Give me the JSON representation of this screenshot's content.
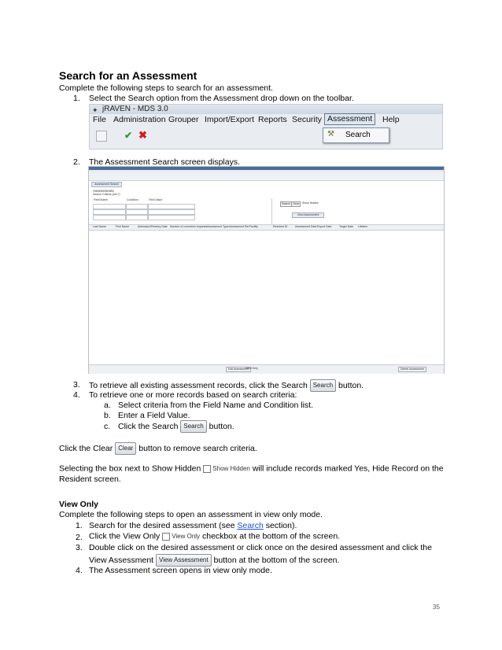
{
  "heading": "Search for an Assessment",
  "intro": "Complete the following steps to search for an assessment.",
  "steps1": [
    {
      "num": "1.",
      "text": "Select the Search option from the Assessment drop down on the toolbar."
    },
    {
      "num": "2.",
      "text": "The Assessment Search screen displays."
    }
  ],
  "toolbar_screenshot": {
    "title": "jRAVEN - MDS 3.0",
    "menus": [
      "File",
      "Administration",
      "Grouper",
      "Import/Export",
      "Reports",
      "Security",
      "Assessment",
      "Help"
    ],
    "dropdown_item": "Search"
  },
  "search_screenshot": {
    "window_title": "Assessment Search",
    "panel_title": "Assessments",
    "criteria_label": "Search Criteria (All=?)",
    "columns_left": [
      "Field Name",
      "Condition",
      "Field Value"
    ],
    "buttons": [
      "Search",
      "Clear",
      "Show Hidden",
      "View Assessment"
    ],
    "result_columns": [
      "Last Name",
      "First Name",
      "Admission/Reentry Date",
      "Number of correction requests",
      "Assessment Type",
      "Assessment Ref",
      "Facility",
      "Resident ID",
      "Assessment Date",
      "Export Date",
      "Target Date",
      "Lifetime"
    ],
    "footer_left": "Edit Assessment",
    "footer_check": "View Only",
    "footer_right": "Delete Assessment"
  },
  "steps2": [
    {
      "num": "3.",
      "pre": "To retrieve all existing assessment records, click the Search",
      "btn": "Search",
      "post": "button."
    },
    {
      "num": "4.",
      "text": "To retrieve one or more records based on search criteria:"
    }
  ],
  "substeps": [
    {
      "letter": "a.",
      "text": "Select criteria from the Field Name and Condition list."
    },
    {
      "letter": "b.",
      "text": "Enter a Field Value."
    },
    {
      "letter": "c.",
      "pre": "Click the Search",
      "btn": "Search",
      "post": "button."
    }
  ],
  "clear_para": {
    "pre": "Click the Clear",
    "btn": "Clear",
    "post": "button to remove search criteria."
  },
  "hidden_para": {
    "pre": "Selecting the box next to Show Hidden",
    "btn": "Show Hidden",
    "post": "will include records marked Yes, Hide Record on the",
    "line2": "Resident screen."
  },
  "view_only": {
    "heading": "View Only",
    "intro": "Complete the following steps to open an assessment in view only mode.",
    "s1_pre": "Search for the desired assessment (see ",
    "s1_link": "Search",
    "s1_post": " section).",
    "s2_pre": "Click the View Only",
    "s2_btn": "View Only",
    "s2_post": "checkbox at the bottom of the screen.",
    "s3_line1": "Double click on the desired assessment or click once on the desired assessment and click the",
    "s3_pre": "View Assessment",
    "s3_btn": "View Assessment",
    "s3_post": "button at the bottom of the screen.",
    "s4": "The Assessment screen opens in view only mode."
  },
  "page_number": "35",
  "colors": {
    "link": "#1a4fd1",
    "save_check_icon": "#2e9b2e",
    "delete_icon": "#d11c1c"
  }
}
